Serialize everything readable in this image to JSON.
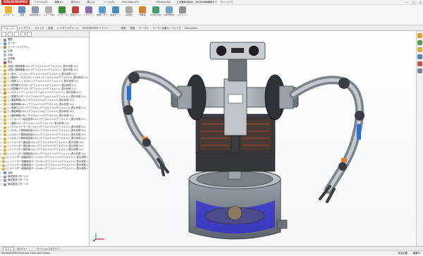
{
  "app": {
    "logo": "SOLIDWORKS",
    "doc_title": "上半身ロボット_Ver2.SLDASM *",
    "win_controls": [
      "—",
      "□",
      "✕"
    ]
  },
  "menu": [
    "ファイル(F)",
    "編集(E)",
    "表示(V)",
    "挿入(I)",
    "ツール(T)",
    "Simulation(S)",
    "Window(W)",
    "ヘルプ(H)",
    "ツールボックス",
    "ウィンドウ"
  ],
  "toolbar": [
    {
      "label": "コンポーネントの挿入",
      "icon": "insert-component-icon",
      "color": "#f0b030"
    },
    {
      "label": "合致",
      "icon": "mate-icon",
      "color": "#6a8fc0"
    },
    {
      "label": "構成部品パターン",
      "icon": "pattern-icon",
      "color": "#8a9ab0"
    },
    {
      "label": "スマート締結部品",
      "icon": "fastener-icon",
      "color": "#b0b0b0"
    },
    {
      "label": "コンポーネント移動",
      "icon": "move-icon",
      "color": "#3c8c3c"
    },
    {
      "label": "非表示コンポーネント",
      "icon": "hide-icon",
      "color": "#c04040"
    },
    {
      "label": "アセンブリフィーチャー",
      "icon": "feature-icon",
      "color": "#8e6cb0"
    },
    {
      "label": "参照ジオメトリ",
      "icon": "reference-icon",
      "color": "#5a9ad0"
    },
    {
      "label": "新規モーションスタディ",
      "icon": "motion-icon",
      "color": "#4090c0"
    },
    {
      "label": "部品表",
      "icon": "bom-icon",
      "color": "#aaaaaa"
    },
    {
      "label": "分解図",
      "icon": "explode-icon",
      "color": "#d08030"
    },
    {
      "label": "Instant3D",
      "icon": "instant3d-icon",
      "color": "#40a070"
    },
    {
      "label": "Speedpak更新",
      "icon": "speedpak-icon",
      "color": "#70a0d0"
    },
    {
      "label": "スナップショット",
      "icon": "snapshot-icon",
      "color": "#909090"
    }
  ],
  "tabs": [
    "アセンブリ",
    "レイアウト",
    "スケッチ",
    "評価",
    "レンダリングツール",
    "SOLIDWORKS アドイン",
    "電気",
    "配管",
    "ケーブル",
    "ユーザー定義ルーティング",
    "Simulation"
  ],
  "tree": [
    {
      "label": "履歴",
      "icon": "history-icon",
      "color": "#888888",
      "toggle": "▸"
    },
    {
      "label": "センサー",
      "icon": "sensor-icon",
      "color": "#3aa0d0",
      "toggle": "▸"
    },
    {
      "label": "アノテートアイテム",
      "icon": "annotation-icon",
      "color": "#c08030",
      "toggle": "▸"
    },
    {
      "label": "正面",
      "icon": "plane-icon",
      "color": "#a0c0e0",
      "toggle": ""
    },
    {
      "label": "平面",
      "icon": "plane-icon",
      "color": "#a0c0e0",
      "toggle": ""
    },
    {
      "label": "右側面",
      "icon": "plane-icon",
      "color": "#a0c0e0",
      "toggle": ""
    },
    {
      "label": "原点",
      "icon": "origin-icon",
      "color": "#d04040",
      "toggle": ""
    },
    {
      "label": "(固定) 胸部骨格<1> (デフォルト<<デフォルト>_表示状態 1>)",
      "icon": "part-icon",
      "color": "#e0b040",
      "toggle": "▸"
    },
    {
      "label": "(固定) 胸部骨格<2> (デフォルト<<デフォルト>_表示状態 1>)",
      "icon": "part-icon",
      "color": "#e0b040",
      "toggle": "▸"
    },
    {
      "label": "(-) 肩ユニット<1> (デフォルト<<デフォルト>_表示状態 1>)",
      "icon": "part-icon",
      "color": "#e0b040",
      "toggle": "▸"
    },
    {
      "label": "(-) 腕部サーボブラケット<1> (デフォルト<<デフォルト>_表示状態 1>)",
      "icon": "part-icon",
      "color": "#e0b040",
      "toggle": "▸"
    },
    {
      "label": "(-) 前腕ユニット<2> (デフォルト<<デフォルト>_表示状態 1>)",
      "icon": "part-icon",
      "color": "#e0b040",
      "toggle": "▸"
    },
    {
      "label": "(-) 肘関節ギア<1> (デフォルト<<デフォルト>_表示状態 1>)",
      "icon": "part-icon",
      "color": "#e0b040",
      "toggle": "▸"
    },
    {
      "label": "(-) 肘関節ギア<2> (デフォルト<<デフォルト>_表示状態 1>)",
      "icon": "part-icon",
      "color": "#e0b040",
      "toggle": "▸"
    },
    {
      "label": "(-) ロボットアーム<1> (デフォルト<<デフォルト>_表示状態 1>)",
      "icon": "assembly-icon",
      "color": "#d09020",
      "toggle": "▸"
    },
    {
      "label": "(-) 電源ホルダーパイプ<1> (デフォルト<<デフォルト>_表示状態 1>)",
      "icon": "part-icon",
      "color": "#e0b040",
      "toggle": "▸"
    },
    {
      "label": "(-) 胸部骨格<3> (デフォルト<<デフォルト>_表示状態 1>)",
      "icon": "part-icon",
      "color": "#e0b040",
      "toggle": "▸"
    },
    {
      "label": "(-) 胸部骨格<4> (デフォルト<<デフォルト>_表示状態 1>)",
      "icon": "part-icon",
      "color": "#e0b040",
      "toggle": "▸"
    },
    {
      "label": "(-) 電源ホルダーパイプ<2> (デフォルト<<デフォルト>_表示状態 1>)",
      "icon": "part-icon",
      "color": "#e0b040",
      "toggle": "▸"
    },
    {
      "label": "(-) 胸部骨格<5> (デフォルト<<デフォルト>_表示状態 1>)",
      "icon": "part-icon",
      "color": "#e0b040",
      "toggle": "▸"
    },
    {
      "label": "(-) 胸部骨格<6> (デフォルト<<デフォルト>_表示状態 1>)",
      "icon": "part-icon",
      "color": "#e0b040",
      "toggle": "▸"
    },
    {
      "label": "(-) ジョイント結合金具<1> (デフォルト<<デフォルト>_表示状態 1>)",
      "icon": "part-icon",
      "color": "#e0b040",
      "toggle": "▸"
    },
    {
      "label": "(-) 頭部<1> (デフォルト<<デフォルト>_表示状態 1>)",
      "icon": "part-icon",
      "color": "#e0b040",
      "toggle": "▸"
    },
    {
      "label": "(-) ダイレクトモーター<1> (デフォルト<<デフォルト>_表示状態 1>)",
      "icon": "part-icon",
      "color": "#e0b040",
      "toggle": "▸"
    },
    {
      "label": "(-) ロボット胴体固定板<1> (デフォルト<<デフォルト>_表示状態 1>)",
      "icon": "part-icon",
      "color": "#e0b040",
      "toggle": "▸"
    },
    {
      "label": "(-) ロボット胴体固定板<2> (デフォルト<<デフォルト>_表示状態 1>)",
      "icon": "part-icon",
      "color": "#e0b040",
      "toggle": "▸"
    },
    {
      "label": "(-) ロボット胴体固定板<3> (デフォルト<<デフォルト>_表示状態 1>)",
      "icon": "part-icon",
      "color": "#e0b040",
      "toggle": "▸"
    },
    {
      "label": "(-) シリンダー固定板<1> (デフォルト<<デフォルト>_表示状態 1>)",
      "icon": "part-icon",
      "color": "#e0b040",
      "toggle": "▸"
    },
    {
      "label": "(-) シリンダー固定板<2> (デフォルト<<デフォルト>_表示状態 1>)",
      "icon": "part-icon",
      "color": "#e0b040",
      "toggle": "▸"
    },
    {
      "label": "(-) シリンダー固定板<3> (デフォルト<<デフォルト>_表示状態 1>)",
      "icon": "part-icon",
      "color": "#e0b040",
      "toggle": "▸"
    },
    {
      "label": "(-) シリンダー保護部品<1> (デフォルト<<デフォルト>_表示状態 1>)",
      "icon": "part-icon",
      "color": "#e0b040",
      "toggle": "▸"
    },
    {
      "label": "(-) シリンダー保護部品ベース<1> (デフォルト<<デフォルト>_表示状態 1>)",
      "icon": "part-icon",
      "color": "#e0b040",
      "toggle": "▸"
    },
    {
      "label": "(-) シリンダー保護部品ベース<2> (デフォルト<<デフォルト>_表示状態 1>)",
      "icon": "part-icon",
      "color": "#e0b040",
      "toggle": "▸"
    },
    {
      "label": "(-) シリンダー保護部品ベース<3> (デフォルト<<デフォルト>_表示状態 1>)",
      "icon": "part-icon",
      "color": "#e0b040",
      "toggle": "▸"
    },
    {
      "label": "(-) シリンダー保護部品ベース<4> (デフォルト<<デフォルト>_表示状態 1>)",
      "icon": "part-icon",
      "color": "#e0b040",
      "toggle": "▸"
    },
    {
      "label": "合致",
      "icon": "mates-folder-icon",
      "color": "#7090c0",
      "toggle": "▸"
    },
    {
      "label": "構成部品パターン1",
      "icon": "pattern-icon",
      "color": "#8a9ab0",
      "toggle": "▸"
    },
    {
      "label": "構成部品パターン2",
      "icon": "pattern-icon",
      "color": "#8a9ab0",
      "toggle": "▸"
    },
    {
      "label": "構成部品パターン3",
      "icon": "pattern-icon",
      "color": "#8a9ab0",
      "toggle": "▸"
    }
  ],
  "bottom_tabs": [
    "モデル",
    "3D ビュー",
    "モーションスタディ 1"
  ],
  "status": {
    "left": "SOLIDWORKS Premium 2016 x64 Edition",
    "right": "完全定義",
    "right2": "編集中"
  },
  "task_pane_icons": [
    {
      "icon": "resources-icon",
      "color": "#e0a030"
    },
    {
      "icon": "design-library-icon",
      "color": "#50a050"
    },
    {
      "icon": "file-explorer-icon",
      "color": "#d0b040"
    },
    {
      "icon": "view-palette-icon",
      "color": "#5080c0"
    },
    {
      "icon": "appearances-icon",
      "color": "#c05050"
    },
    {
      "icon": "custom-properties-icon",
      "color": "#8080a0"
    }
  ]
}
